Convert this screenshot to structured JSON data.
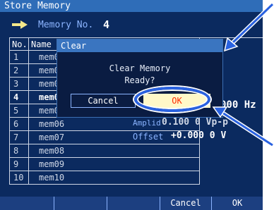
{
  "window": {
    "title": "Store Memory"
  },
  "memory_no": {
    "label": "Memory No.",
    "value": "4"
  },
  "table": {
    "headers": {
      "no": "No.",
      "name": "Name"
    },
    "rows": [
      {
        "no": "1",
        "name": "mem01"
      },
      {
        "no": "2",
        "name": "mem02"
      },
      {
        "no": "3",
        "name": "mem03"
      },
      {
        "no": "4",
        "name": "mem04"
      },
      {
        "no": "5",
        "name": "mem05"
      },
      {
        "no": "6",
        "name": "mem06"
      },
      {
        "no": "7",
        "name": "mem07"
      },
      {
        "no": "8",
        "name": "mem08"
      },
      {
        "no": "9",
        "name": "mem09"
      },
      {
        "no": "10",
        "name": "mem10"
      }
    ],
    "selected_index": 3
  },
  "preview": {
    "freq_unit": "000 Hz",
    "ampl_label": "Amplid",
    "ampl_value": "0.100 0 Vp-p",
    "offset_label": "Offset",
    "offset_value": "+0.000 0 V"
  },
  "dialog": {
    "title": "Clear",
    "line1": "Clear Memory",
    "line2": "Ready?",
    "cancel_label": "Cancel",
    "ok_label": "OK"
  },
  "softkeys": [
    "",
    "",
    "",
    "Cancel",
    "OK"
  ],
  "colors": {
    "screen_bg": "#0b2a5f",
    "title_bar": "#2f6db8",
    "ok_text": "#ff2a00",
    "ok_bg": "#fff8c8",
    "highlight": "#2a62e0"
  }
}
